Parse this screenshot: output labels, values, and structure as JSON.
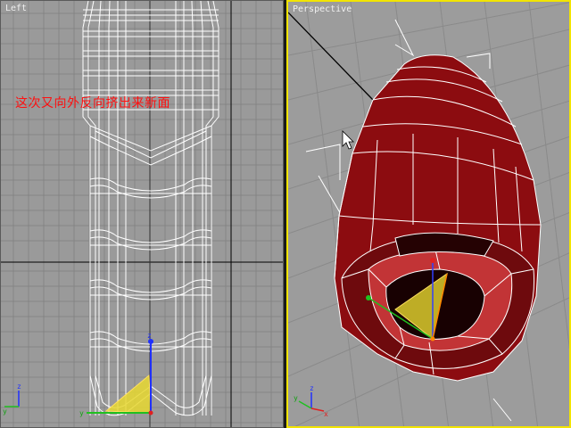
{
  "viewports": {
    "left": {
      "label": "Left"
    },
    "perspective": {
      "label": "Perspective"
    }
  },
  "annotation": {
    "text": "这次又向外反向挤出来新面"
  },
  "gizmo": {
    "x": "x",
    "y": "y",
    "z": "z"
  },
  "colors": {
    "viewport_bg": "#9a9a9a",
    "grid_line": "#808080",
    "grid_major": "#000000",
    "wireframe": "#ffffff",
    "mesh_red": "#8c0c10",
    "active_border": "#f2e400",
    "annotation": "#ff1010",
    "selection_yellow": "#e8d830"
  }
}
